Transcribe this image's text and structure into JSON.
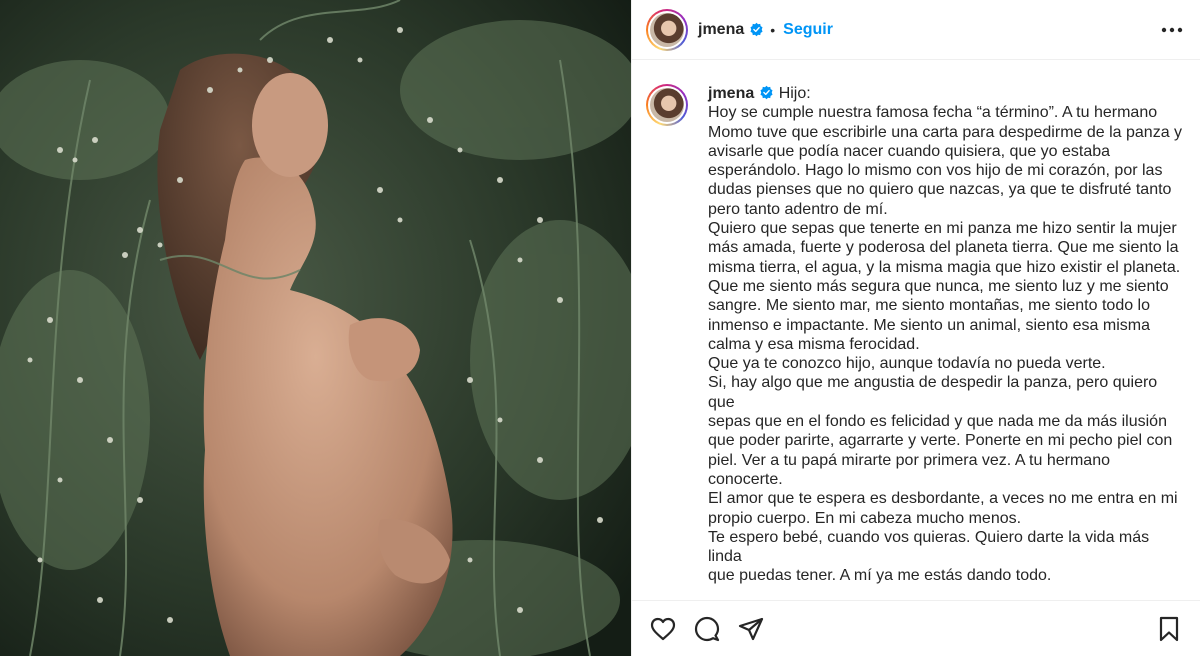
{
  "header": {
    "username": "jmena",
    "separator": "•",
    "follow_label": "Seguir"
  },
  "caption": {
    "username": "jmena",
    "text": " Hijo:\nHoy se cumple nuestra famosa fecha “a término”. A tu hermano\nMomo tuve que escribirle una carta para despedirme de la panza y\navisarle que podía nacer cuando quisiera, que yo estaba\nesperándolo. Hago lo mismo con vos hijo de mi corazón, por las\ndudas pienses que no quiero que nazcas, ya que te disfruté tanto\npero tanto adentro de mí.\nQuiero que sepas que tenerte en mi panza me hizo sentir la mujer\nmás amada, fuerte y poderosa del planeta tierra. Que me siento la\nmisma tierra, el agua, y la misma magia que hizo existir el planeta.\nQue me siento más segura que nunca, me siento luz y me siento\nsangre. Me siento mar, me siento montañas, me siento todo lo\ninmenso e impactante. Me siento un animal, siento esa misma\ncalma y esa misma ferocidad.\nQue ya te conozco hijo, aunque todavía no pueda verte.\nSi, hay algo que me angustia de despedir la panza, pero quiero que\nsepas que en el fondo es felicidad y que nada me da más ilusión\nque poder parirte, agarrarte y verte. Ponerte en mi pecho piel con\npiel. Ver a tu papá mirarte por primera vez. A tu hermano\nconocerte.\nEl amor que te espera es desbordante, a veces no me entra en mi\npropio cuerpo. En mi cabeza mucho menos.\nTe espero bebé, cuando vos quieras. Quiero darte la vida más linda\nque puedas tener. A mí ya me estás dando todo."
  },
  "icons": {
    "verified": "verified-badge-icon",
    "more": "more-options-icon",
    "like": "heart-icon",
    "comment": "comment-bubble-icon",
    "share": "paper-plane-icon",
    "save": "bookmark-icon"
  },
  "colors": {
    "accent": "#0095f6",
    "text": "#262626",
    "border": "#efefef"
  }
}
